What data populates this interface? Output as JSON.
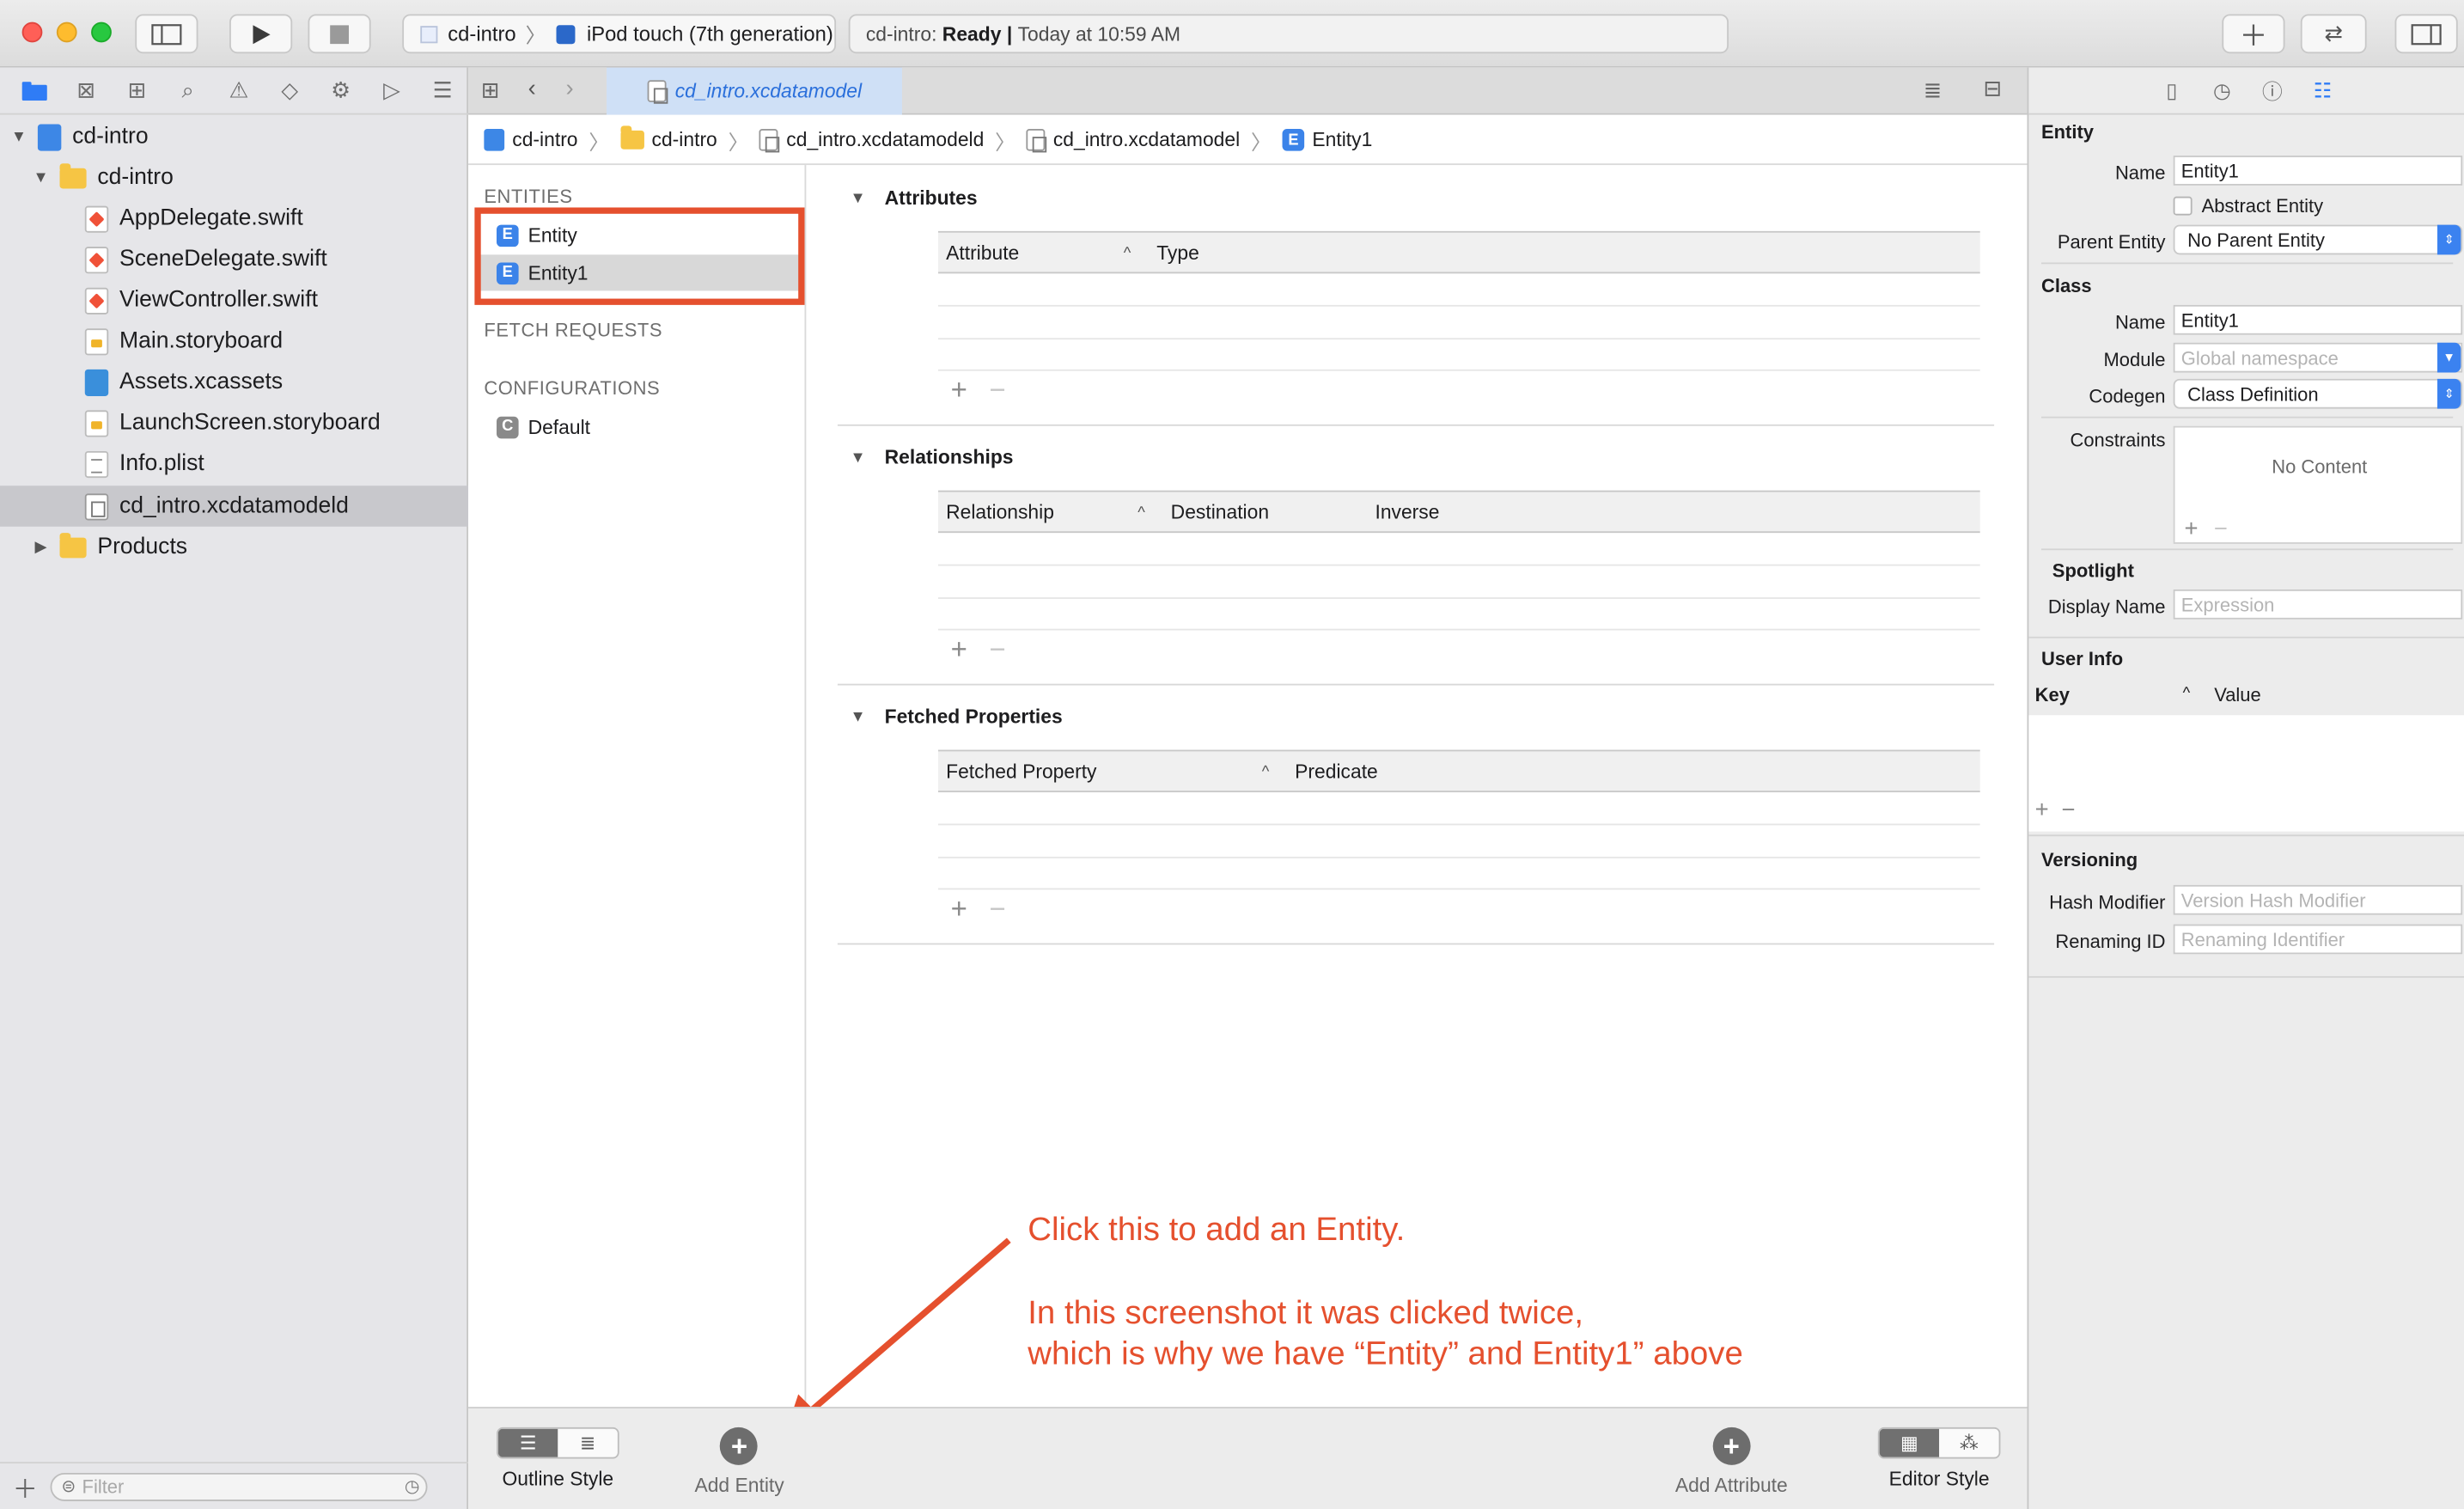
{
  "toolbar": {
    "scheme_target": "cd-intro",
    "scheme_device": "iPod touch (7th generation)",
    "status_project": "cd-intro:",
    "status_state": "Ready",
    "status_sep": "|",
    "status_time": "Today at 10:59 AM"
  },
  "navigator": {
    "items": [
      {
        "label": "cd-intro"
      },
      {
        "label": "cd-intro"
      },
      {
        "label": "AppDelegate.swift"
      },
      {
        "label": "SceneDelegate.swift"
      },
      {
        "label": "ViewController.swift"
      },
      {
        "label": "Main.storyboard"
      },
      {
        "label": "Assets.xcassets"
      },
      {
        "label": "LaunchScreen.storyboard"
      },
      {
        "label": "Info.plist"
      },
      {
        "label": "cd_intro.xcdatamodeld"
      },
      {
        "label": "Products"
      }
    ],
    "filter_placeholder": "Filter"
  },
  "editor": {
    "tab_title": "cd_intro.xcdatamodel",
    "breadcrumb": [
      "cd-intro",
      "cd-intro",
      "cd_intro.xcdatamodeld",
      "cd_intro.xcdatamodel",
      "Entity1"
    ],
    "entities_header": "ENTITIES",
    "entities": [
      "Entity",
      "Entity1"
    ],
    "entity_icon_letter": "E",
    "fetch_requests_header": "FETCH REQUESTS",
    "configurations_header": "CONFIGURATIONS",
    "configuration_icon_letter": "C",
    "configurations": [
      "Default"
    ],
    "attributes": {
      "title": "Attributes",
      "col1": "Attribute",
      "col2": "Type"
    },
    "relationships": {
      "title": "Relationships",
      "col1": "Relationship",
      "col2": "Destination",
      "col3": "Inverse"
    },
    "fetched": {
      "title": "Fetched Properties",
      "col1": "Fetched Property",
      "col2": "Predicate"
    },
    "annotation": {
      "line1": "Click this to add an Entity.",
      "line2": "In this screenshot it was clicked twice,",
      "line3": "which is why we have “Entity” and Entity1” above"
    },
    "bottom": {
      "outline_style": "Outline Style",
      "add_entity": "Add Entity",
      "add_attribute": "Add Attribute",
      "editor_style": "Editor Style"
    }
  },
  "inspector": {
    "entity_header": "Entity",
    "name_label": "Name",
    "entity_name": "Entity1",
    "abstract_label": "Abstract Entity",
    "parent_label": "Parent Entity",
    "parent_value": "No Parent Entity",
    "class_header": "Class",
    "class_name_label": "Name",
    "class_name": "Entity1",
    "module_label": "Module",
    "module_placeholder": "Global namespace",
    "codegen_label": "Codegen",
    "codegen_value": "Class Definition",
    "constraints_label": "Constraints",
    "constraints_empty": "No Content",
    "spotlight_header": "Spotlight",
    "display_name_label": "Display Name",
    "display_name_placeholder": "Expression",
    "user_info_header": "User Info",
    "key_col": "Key",
    "value_col": "Value",
    "versioning_header": "Versioning",
    "hash_label": "Hash Modifier",
    "hash_placeholder": "Version Hash Modifier",
    "renaming_label": "Renaming ID",
    "renaming_placeholder": "Renaming Identifier"
  },
  "colors": {
    "annotation": "#e5502e",
    "accent": "#2f7cf6"
  }
}
